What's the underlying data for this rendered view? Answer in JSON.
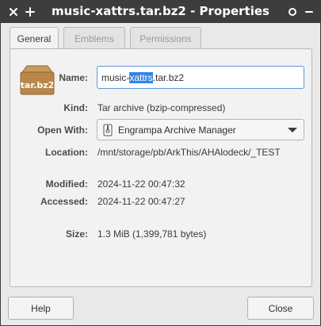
{
  "window": {
    "title": "music-xattrs.tar.bz2 - Properties"
  },
  "titlebar_icons": {
    "close": "close-icon",
    "add": "plus-icon",
    "menu": "menu-icon",
    "minimize": "minimize-icon"
  },
  "tabs": [
    {
      "label": "General",
      "active": true
    },
    {
      "label": "Emblems",
      "active": false
    },
    {
      "label": "Permissions",
      "active": false
    }
  ],
  "file_icon": {
    "name": "archive-box-icon",
    "text": "tar.bz2"
  },
  "fields": {
    "name_label": "Name:",
    "name_prefix": "music-",
    "name_selected": "xattrs",
    "name_suffix": ".tar.bz2",
    "kind_label": "Kind:",
    "kind_value": "Tar archive (bzip-compressed)",
    "open_with_label": "Open With:",
    "open_with_value": "Engrampa Archive Manager",
    "location_label": "Location:",
    "location_value": "/mnt/storage/pb/ArkThis/AHAlodeck/_TEST",
    "modified_label": "Modified:",
    "modified_value": "2024-11-22 00:47:32",
    "accessed_label": "Accessed:",
    "accessed_value": "2024-11-22 00:47:27",
    "size_label": "Size:",
    "size_value": "1.3 MiB (1,399,781 bytes)"
  },
  "buttons": {
    "help": "Help",
    "close": "Close"
  },
  "colors": {
    "titlebar": "#3d3d3d",
    "selection": "#3584e4",
    "focus_border": "#5b9bd5"
  }
}
